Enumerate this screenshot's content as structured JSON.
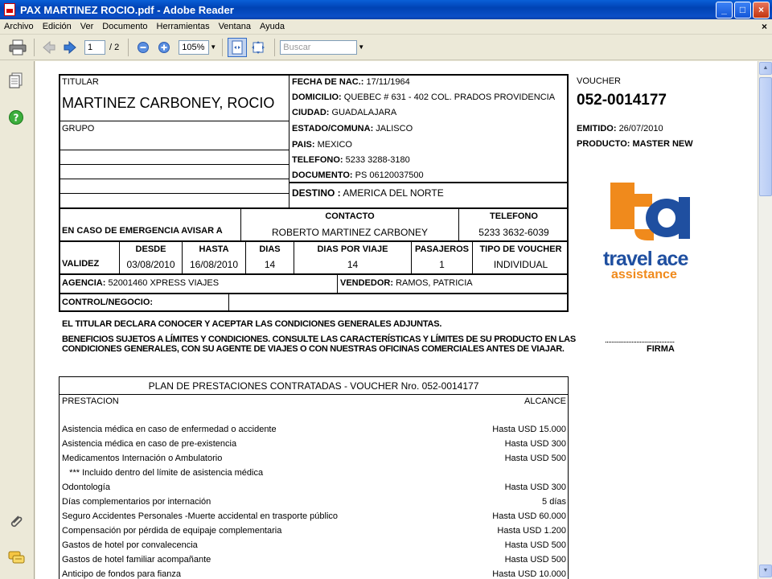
{
  "window": {
    "title": "PAX MARTINEZ ROCIO.pdf - Adobe Reader",
    "buttons": {
      "minimize": "_",
      "maximize": "□",
      "close": "×"
    }
  },
  "menu": [
    "Archivo",
    "Edición",
    "Ver",
    "Documento",
    "Herramientas",
    "Ventana",
    "Ayuda"
  ],
  "menu_close": "×",
  "toolbar": {
    "page_current": "1",
    "page_total": "/ 2",
    "zoom": "105%",
    "search_placeholder": "Buscar"
  },
  "voucher_header": {
    "titular_label": "TITULAR",
    "titular_name": "MARTINEZ CARBONEY, ROCIO",
    "grupo_label": "GRUPO",
    "fecha_label": "FECHA DE NAC.:",
    "fecha_value": "17/11/1964",
    "domicilio_label": "DOMICILIO:",
    "domicilio_value": "QUEBEC # 631 - 402 COL. PRADOS PROVIDENCIA",
    "ciudad_label": "CIUDAD:",
    "ciudad_value": "GUADALAJARA",
    "estado_label": "ESTADO/COMUNA:",
    "estado_value": "JALISCO",
    "pais_label": "PAIS:",
    "pais_value": "MEXICO",
    "telefono_label": "TELEFONO:",
    "telefono_value": "5233 3288-3180",
    "documento_label": "DOCUMENTO:",
    "documento_value": "PS  06120037500",
    "destino_label": "DESTINO :",
    "destino_value": "AMERICA DEL NORTE"
  },
  "emergency": {
    "label": "EN CASO DE EMERGENCIA AVISAR A",
    "contacto_label": "CONTACTO",
    "contacto_value": "ROBERTO MARTINEZ CARBONEY",
    "telefono_label": "TELEFONO",
    "telefono_value": "5233 3632-6039"
  },
  "validity": {
    "label": "VALIDEZ",
    "desde_label": "DESDE",
    "desde_value": "03/08/2010",
    "hasta_label": "HASTA",
    "hasta_value": "16/08/2010",
    "dias_label": "DIAS",
    "dias_value": "14",
    "dias_viaje_label": "DIAS POR VIAJE",
    "dias_viaje_value": "14",
    "pasajeros_label": "PASAJEROS",
    "pasajeros_value": "1",
    "tipo_label": "TIPO DE VOUCHER",
    "tipo_value": "INDIVIDUAL"
  },
  "agency": {
    "agencia_label": "AGENCIA:",
    "agencia_value": "52001460 XPRESS VIAJES",
    "vendedor_label": "VENDEDOR:",
    "vendedor_value": "RAMOS, PATRICIA",
    "control_label": "CONTROL/NEGOCIO:"
  },
  "voucher_side": {
    "voucher_label": "VOUCHER",
    "voucher_number": "052-0014177",
    "emitido_label": "EMITIDO:",
    "emitido_value": "26/07/2010",
    "producto_label": "PRODUCTO:",
    "producto_value": "MASTER NEW",
    "logo_line1": "travel ace",
    "logo_line2": "assistance",
    "firma_dots": "..........................................",
    "firma_label": "FIRMA"
  },
  "declaration": {
    "line1": "EL TITULAR DECLARA CONOCER Y ACEPTAR LAS CONDICIONES GENERALES ADJUNTAS.",
    "line2": "BENEFICIOS SUJETOS A LÍMITES Y CONDICIONES. CONSULTE LAS CARACTERÍSTICAS Y LÍMITES DE SU PRODUCTO EN LAS",
    "line3": "CONDICIONES GENERALES, CON SU AGENTE DE VIAJES O CON NUESTRAS OFICINAS COMERCIALES ANTES DE VIAJAR."
  },
  "plan": {
    "title": "PLAN DE PRESTACIONES CONTRATADAS - VOUCHER Nro. 052-0014177",
    "col_prestacion": "PRESTACION",
    "col_alcance": "ALCANCE",
    "rows": [
      {
        "name": "Asistencia médica en caso de enfermedad o accidente",
        "value": "Hasta USD 15.000"
      },
      {
        "name": "Asistencia médica en caso de pre-existencia",
        "value": "Hasta USD 300"
      },
      {
        "name": "Medicamentos Internación o Ambulatorio",
        "value": "Hasta USD 500"
      },
      {
        "name": "   *** Incluido dentro del límite de asistencia médica",
        "value": ""
      },
      {
        "name": "Odontología",
        "value": "Hasta USD 300"
      },
      {
        "name": "Días complementarios por internación",
        "value": "5 días"
      },
      {
        "name": "Seguro Accidentes Personales -Muerte accidental en trasporte público",
        "value": "Hasta USD 60.000"
      },
      {
        "name": "Compensación por pérdida de equipaje complementaria",
        "value": "Hasta USD 1.200"
      },
      {
        "name": "Gastos de hotel por convalecencia",
        "value": "Hasta USD 500"
      },
      {
        "name": "Gastos de hotel familiar acompañante",
        "value": "Hasta USD 500"
      },
      {
        "name": "Anticipo de fondos para fianza",
        "value": "Hasta USD 10.000"
      }
    ]
  },
  "colors": {
    "titlebar": "#0a5fd8",
    "logo_orange": "#f08a1c",
    "logo_blue": "#1f4fa0"
  }
}
